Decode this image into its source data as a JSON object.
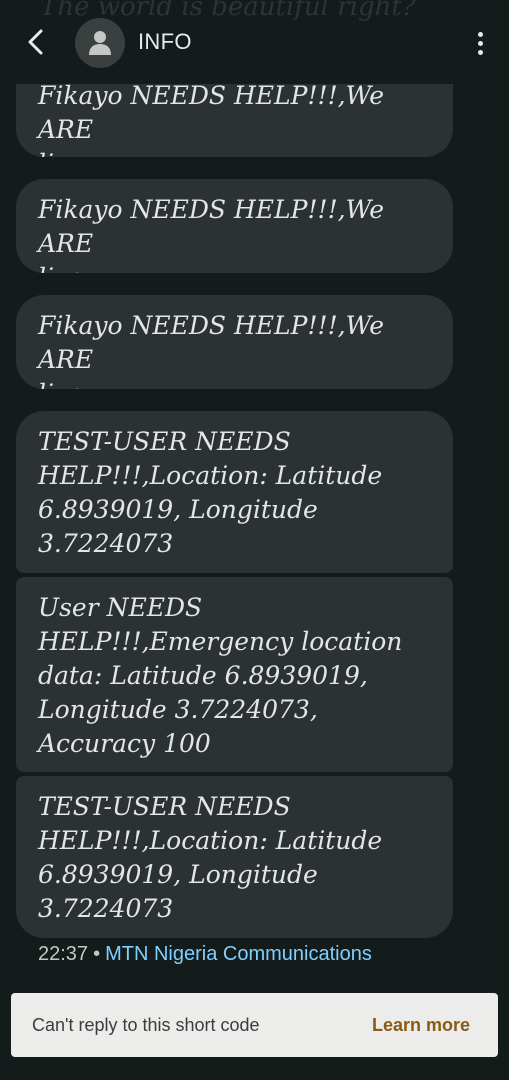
{
  "header": {
    "ghost_text": "The world is beautiful right?",
    "contact_name": "INFO",
    "back_icon": "chevron-left-icon",
    "avatar_icon": "person-icon",
    "menu_icon": "more-vertical-icon"
  },
  "messages": [
    {
      "line1": "Fikayo NEEDS HELP!!!,We ARE",
      "line2": "live"
    },
    {
      "line1": "Fikayo NEEDS HELP!!!,We ARE",
      "line2": "live"
    },
    {
      "line1": "Fikayo NEEDS HELP!!!,We ARE",
      "line2": "live"
    },
    {
      "line1": "TEST-USER NEEDS",
      "line2": "HELP!!!,Location: Latitude",
      "line3": "6.8939019, Longitude",
      "line4": "3.7224073"
    },
    {
      "line1": "User NEEDS",
      "line2": "HELP!!!,Emergency location",
      "line3": "data: Latitude 6.8939019,",
      "line4": "Longitude 3.7224073,",
      "line5": "Accuracy 100"
    },
    {
      "line1": "TEST-USER NEEDS",
      "line2": "HELP!!!,Location: Latitude",
      "line3": "6.8939019, Longitude",
      "line4": "3.7224073"
    }
  ],
  "meta": {
    "time": "22:37",
    "separator": "•",
    "sender": "MTN Nigeria Communications"
  },
  "reply_bar": {
    "text": "Can't reply to this short code",
    "learn_more": "Learn more"
  },
  "colors": {
    "background": "#141b1b",
    "bubble": "#2c3234",
    "sender_link": "#7fcfff",
    "learn_more": "#8a5a14",
    "reply_bar": "#ececea"
  }
}
